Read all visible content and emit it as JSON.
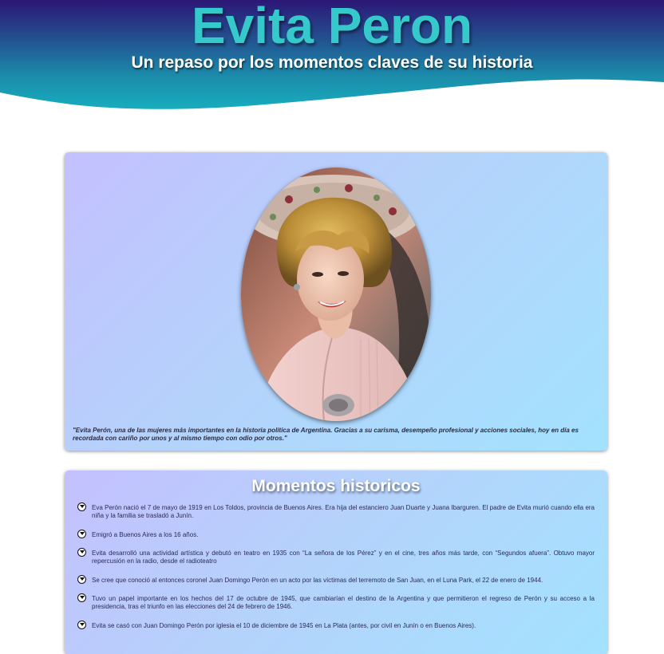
{
  "header": {
    "title": "Evita Peron",
    "subtitle": "Un repaso por los momentos claves de su historia"
  },
  "portrait_card": {
    "image": "portrait-photo",
    "quote": "\"Evita Perón, una de las mujeres más importantes en la historia política de Argentina. Gracias a su carisma, desempeño profesional y acciones sociales, hoy en día es recordada con cariño por unos y al mismo tiempo con odio por otros.\""
  },
  "moments": {
    "title": "Momentos historicos",
    "bullet_icon": "circle-chevron-down-icon",
    "items": [
      "Eva Perón nació el 7 de mayo de 1919 en Los Toldos, provincia de Buenos Aires. Era hija del estanciero Juan Duarte y Juana Ibarguren. El padre de Evita murió cuando ella era niña y la familia se trasladó a Junín.",
      "Emigró a Buenos Aires a los 16 años.",
      "Evita desarrolló una actividad artística y debutó en teatro en 1935 con “La señora de los Pérez” y en el cine, tres años más tarde, con “Segundos afuera”. Obtuvo mayor repercusión en la radio, desde el radioteatro",
      "Se cree que conoció al entonces coronel Juan Domingo Perón en un acto por las víctimas del terremoto de San Juan, en el Luna Park, el 22 de enero de 1944.",
      "Tuvo un papel importante en los hechos del 17 de octubre de 1945, que cambiarían el destino de la Argentina y que permitieron el regreso de Perón y su acceso a la presidencia, tras el triunfo en las elecciones del 24 de febrero de 1946.",
      "Evita se casó con Juan Domingo Perón por iglesia el 10 de diciembre de 1945 en La Plata (antes, por civil en Junín o en Buenos Aires)."
    ]
  },
  "colors": {
    "title": "#35c9cc",
    "header_top": "#2b1a78",
    "header_bottom": "#1aa3b6",
    "card_gradient_start": "#c4c0ff",
    "card_gradient_end": "#a3e2ff"
  }
}
